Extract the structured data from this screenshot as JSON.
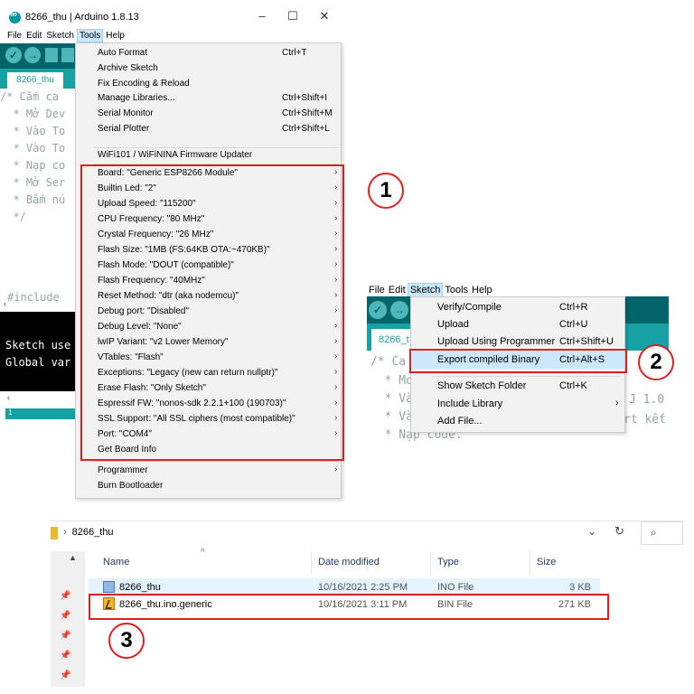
{
  "win1": {
    "title": "8266_thu | Arduino 1.8.13",
    "controls": {
      "minimize": "–",
      "maximize": "☐",
      "close": "✕"
    },
    "menu": [
      "File",
      "Edit",
      "Sketch",
      "Tools",
      "Help"
    ],
    "tab": "8266_thu",
    "code_lines": [
      "/* Cắm ca",
      "  * Mở Dev",
      "  * Vào To",
      "  * Vào To",
      "  * Nạp co",
      "  * Mở Ser",
      "  * Bấm nú",
      "  */"
    ],
    "include_line": "#include",
    "console_lines": [
      "Sketch use",
      "Global var"
    ],
    "status_line": "1"
  },
  "tools_menu": {
    "top_items": [
      {
        "label": "Auto Format",
        "shortcut": "Ctrl+T"
      },
      {
        "label": "Archive Sketch",
        "shortcut": ""
      },
      {
        "label": "Fix Encoding & Reload",
        "shortcut": ""
      },
      {
        "label": "Manage Libraries...",
        "shortcut": "Ctrl+Shift+I"
      },
      {
        "label": "Serial Monitor",
        "shortcut": "Ctrl+Shift+M"
      },
      {
        "label": "Serial Plotter",
        "shortcut": "Ctrl+Shift+L"
      }
    ],
    "firmware_updater": "WiFi101 / WiFiNINA Firmware Updater",
    "board_items": [
      {
        "label": "Board: \"Generic ESP8266 Module\"",
        "submenu": true
      },
      {
        "label": "Builtin Led: \"2\"",
        "submenu": true
      },
      {
        "label": "Upload Speed: \"115200\"",
        "submenu": true
      },
      {
        "label": "CPU Frequency: \"80 MHz\"",
        "submenu": true
      },
      {
        "label": "Crystal Frequency: \"26 MHz\"",
        "submenu": true
      },
      {
        "label": "Flash Size: \"1MB (FS:64KB OTA:~470KB)\"",
        "submenu": true
      },
      {
        "label": "Flash Mode: \"DOUT (compatible)\"",
        "submenu": true
      },
      {
        "label": "Flash Frequency: \"40MHz\"",
        "submenu": true
      },
      {
        "label": "Reset Method: \"dtr (aka nodemcu)\"",
        "submenu": true
      },
      {
        "label": "Debug port: \"Disabled\"",
        "submenu": true
      },
      {
        "label": "Debug Level: \"None\"",
        "submenu": true
      },
      {
        "label": "lwIP Variant: \"v2 Lower Memory\"",
        "submenu": true
      },
      {
        "label": "VTables: \"Flash\"",
        "submenu": true
      },
      {
        "label": "Exceptions: \"Legacy (new can return nullptr)\"",
        "submenu": true
      },
      {
        "label": "Erase Flash: \"Only Sketch\"",
        "submenu": true
      },
      {
        "label": "Espressif FW: \"nonos-sdk 2.2.1+100 (190703)\"",
        "submenu": true
      },
      {
        "label": "SSL Support: \"All SSL ciphers (most compatible)\"",
        "submenu": true
      },
      {
        "label": "Port: \"COM4\"",
        "submenu": true
      },
      {
        "label": "Get Board Info",
        "submenu": false
      }
    ],
    "bottom_items": [
      {
        "label": "Programmer",
        "submenu": true
      },
      {
        "label": "Burn Bootloader",
        "submenu": false
      }
    ],
    "submenu_arrow": "›"
  },
  "badges": {
    "one": "1",
    "two": "2",
    "three": "3"
  },
  "win2": {
    "menu": [
      "File",
      "Edit",
      "Sketch",
      "Tools",
      "Help"
    ],
    "tab": "8266_t",
    "code_lines": [
      "/* Ca",
      "  * Mo",
      "  * Và",
      "  * Và",
      "  * Nạp code."
    ],
    "code_right": [
      "J 1.0",
      "rt kết"
    ],
    "sketch_menu": [
      {
        "label": "Verify/Compile",
        "shortcut": "Ctrl+R"
      },
      {
        "label": "Upload",
        "shortcut": "Ctrl+U"
      },
      {
        "label": "Upload Using Programmer",
        "shortcut": "Ctrl+Shift+U"
      },
      {
        "label": "Export compiled Binary",
        "shortcut": "Ctrl+Alt+S"
      },
      {
        "label": "Show Sketch Folder",
        "shortcut": "Ctrl+K"
      },
      {
        "label": "Include Library",
        "shortcut": "",
        "submenu": true
      },
      {
        "label": "Add File...",
        "shortcut": ""
      }
    ]
  },
  "explorer": {
    "path": "8266_thu",
    "path_sep": "›",
    "columns": [
      "Name",
      "Date modified",
      "Type",
      "Size"
    ],
    "files": [
      {
        "name": "8266_thu",
        "date": "10/16/2021 2:25 PM",
        "type": "INO File",
        "size": "3 KB"
      },
      {
        "name": "8266_thu.ino.generic",
        "date": "10/16/2021 3:11 PM",
        "type": "BIN File",
        "size": "271 KB"
      }
    ],
    "sort_arrow": "^",
    "refresh": "↻",
    "search_icon": "⌕",
    "dropdown": "⌄",
    "pin": "📌"
  },
  "accent": {
    "teal_dark": "#006468",
    "teal": "#17a1a5",
    "highlight": "#e02020"
  }
}
